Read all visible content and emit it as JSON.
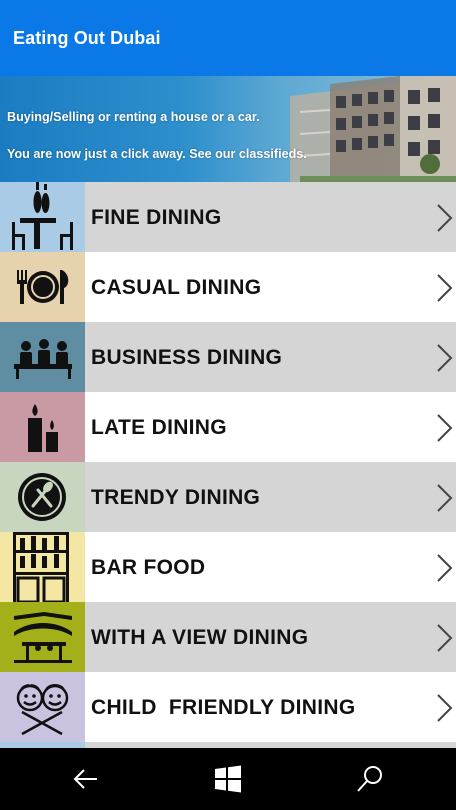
{
  "app": {
    "title": "Eating Out Dubai"
  },
  "banner": {
    "line1": "Buying/Selling or renting a house or a car.",
    "line2": "You are now just a click away. See our classifieds."
  },
  "categories": [
    {
      "label": "FINE DINING",
      "icon": "dining-table-icon",
      "thumb_color": "#a9cbe6"
    },
    {
      "label": "CASUAL DINING",
      "icon": "plate-cutlery-icon",
      "thumb_color": "#e6d2ad"
    },
    {
      "label": "BUSINESS DINING",
      "icon": "business-meeting-icon",
      "thumb_color": "#5f8ea3"
    },
    {
      "label": "LATE DINING",
      "icon": "candles-icon",
      "thumb_color": "#c99aa3"
    },
    {
      "label": "TRENDY DINING",
      "icon": "spoon-fork-badge-icon",
      "thumb_color": "#c8d6bf"
    },
    {
      "label": "BAR FOOD",
      "icon": "bar-shelf-icon",
      "thumb_color": "#f4e7a4"
    },
    {
      "label": "WITH A VIEW DINING",
      "icon": "skyline-view-icon",
      "thumb_color": "#a3b01a"
    },
    {
      "label": "CHILD  FRIENDLY DINING",
      "icon": "children-faces-icon",
      "thumb_color": "#c9c3e0"
    }
  ],
  "navbar": {
    "back": "back-arrow-icon",
    "home": "windows-logo-icon",
    "search": "search-icon"
  }
}
